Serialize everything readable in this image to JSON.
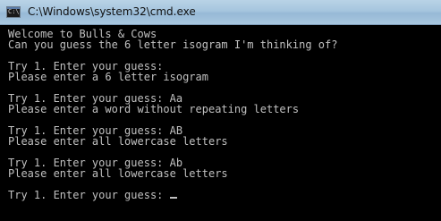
{
  "window": {
    "title": "C:\\Windows\\system32\\cmd.exe",
    "icon": "console-app-icon",
    "icon_text": "C:\\"
  },
  "console": {
    "lines": [
      "Welcome to Bulls & Cows",
      "Can you guess the 6 letter isogram I'm thinking of?",
      "",
      "Try 1. Enter your guess:",
      "Please enter a 6 letter isogram",
      "",
      "Try 1. Enter your guess: Aa",
      "Please enter a word without repeating letters",
      "",
      "Try 1. Enter your guess: AB",
      "Please enter all lowercase letters",
      "",
      "Try 1. Enter your guess: Ab",
      "Please enter all lowercase letters",
      "",
      "Try 1. Enter your guess: "
    ],
    "text_color": "#c0c0c0",
    "background_color": "#000000"
  }
}
